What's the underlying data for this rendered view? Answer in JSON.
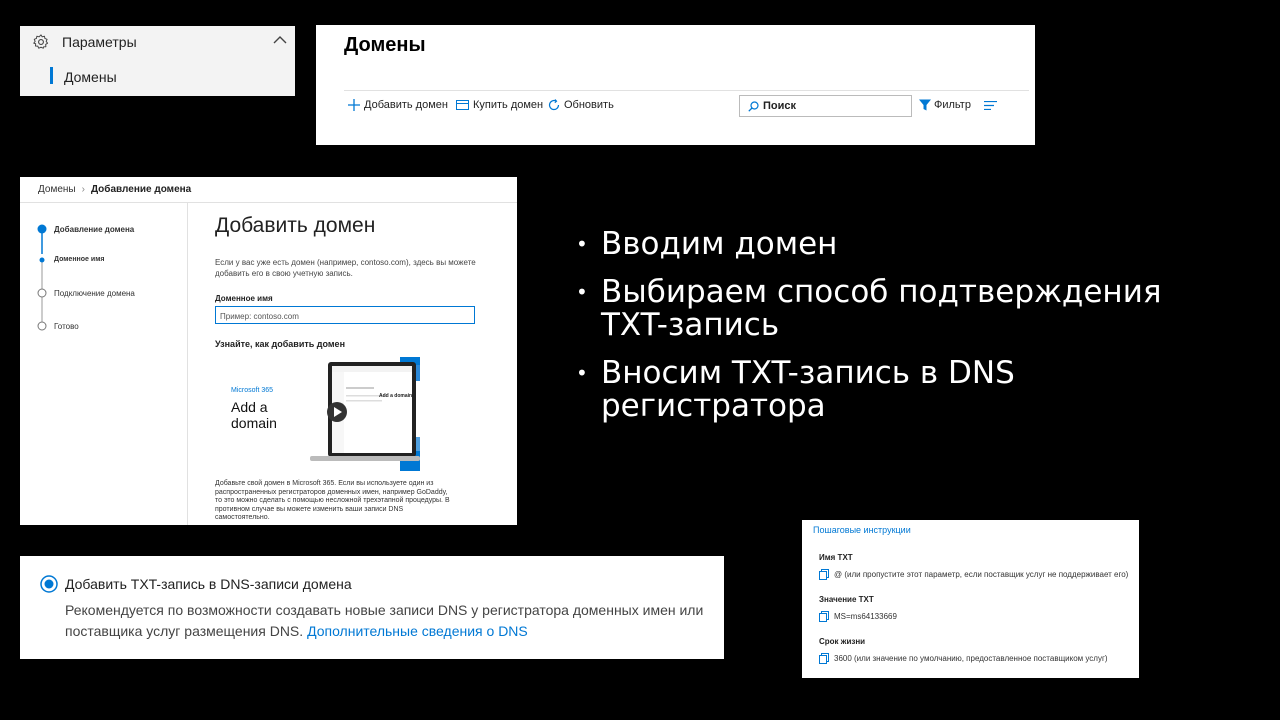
{
  "settings_nav": {
    "parent_label": "Параметры",
    "child_label": "Домены"
  },
  "domains_page": {
    "title": "Домены",
    "toolbar": {
      "add": "Добавить домен",
      "buy": "Купить домен",
      "refresh": "Обновить",
      "search_placeholder": "Поиск",
      "filter": "Фильтр"
    }
  },
  "wizard": {
    "breadcrumb": [
      "Домены",
      "Добавление домена"
    ],
    "steps": [
      {
        "label": "Добавление домена",
        "state": "active"
      },
      {
        "label": "Доменное имя",
        "state": "current-sub"
      },
      {
        "label": "Подключение домена",
        "state": "pending"
      },
      {
        "label": "Готово",
        "state": "pending"
      }
    ],
    "heading": "Добавить домен",
    "description": "Если у вас уже есть домен (например, contoso.com), здесь вы можете добавить его в свою учетную запись.",
    "field_label": "Доменное имя",
    "field_placeholder": "Пример: contoso.com",
    "learn_heading": "Узнайте, как добавить домен",
    "video": {
      "brand": "Microsoft 365",
      "title": "Add a domain",
      "screen_heading": "Add a domain"
    },
    "footer": "Добавьте свой домен в Microsoft 365. Если вы используете один из распространенных регистраторов доменных имен, например GoDaddy, то это можно сделать с помощью несложной трехэтапной процедуры. В противном случае вы можете изменить ваши записи DNS самостоятельно."
  },
  "bullets": [
    "Вводим домен",
    "Выбираем способ подтверждения TXT-запись",
    "Вносим TXT-запись в DNS регистратора"
  ],
  "txt_option": {
    "title": "Добавить TXT-запись в DNS-записи домена",
    "text": "Рекомендуется по возможности создавать новые записи DNS у регистратора доменных имен или поставщика услуг размещения DNS.",
    "link": "Дополнительные сведения о DNS",
    "selected": true
  },
  "instructions": {
    "link": "Пошаговые инструкции",
    "fields": [
      {
        "label": "Имя TXT",
        "value": "@ (или пропустите этот параметр, если поставщик услуг не поддерживает его)"
      },
      {
        "label": "Значение TXT",
        "value": "MS=ms64133669"
      },
      {
        "label": "Срок жизни",
        "value": "3600 (или значение по умолчанию, предоставленное поставщиком услуг)"
      }
    ]
  },
  "colors": {
    "accent": "#0078d4",
    "background": "#000000"
  }
}
